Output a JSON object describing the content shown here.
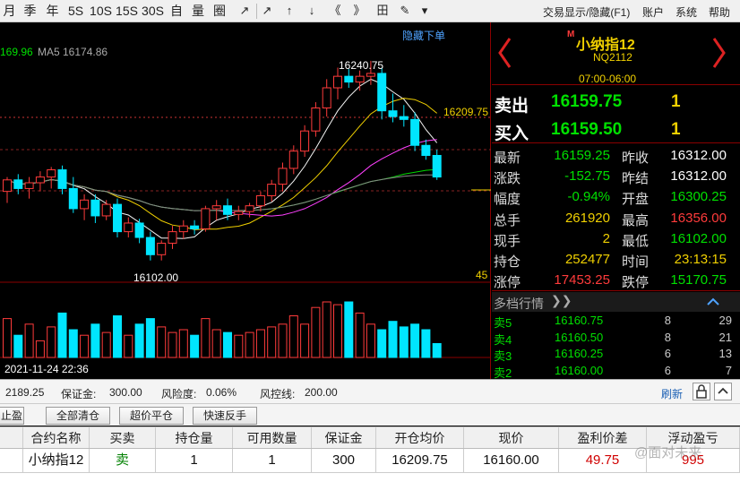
{
  "toolbar": {
    "periods": [
      "月",
      "季",
      "年",
      "5S",
      "10S",
      "15S",
      "30S",
      "自",
      "量",
      "圈"
    ],
    "tools": [
      "↗",
      "↗",
      "↑",
      "↓",
      "《",
      "》",
      "田",
      "✎",
      "▾"
    ],
    "tool_icons": [
      "arrow-diagonal-icon",
      "compress-icon",
      "up-arrow-icon",
      "down-arrow-icon",
      "double-left-icon",
      "double-right-icon",
      "grid-icon",
      "pen-icon",
      "dropdown-icon"
    ],
    "menu": {
      "trade_toggle": "交易显示/隐藏(F1)",
      "account": "账户",
      "system": "系统",
      "help": "帮助"
    }
  },
  "chart": {
    "ma_first_value": "169.96",
    "ma5_label": "MA5",
    "ma5_value": "16174.86",
    "hide_order_link": "隐藏下单",
    "high_label": "16240.75",
    "low_label": "16102.00",
    "price_line_label": "16209.75",
    "countdown_label": "45",
    "datetime_label": "2021-11-24 22:36",
    "colors": {
      "up": "#ff3b3b",
      "down": "#00e5ff",
      "ma5": "#f5f5f5",
      "ma10": "#f0d000",
      "ma20": "#ff40ff",
      "ma60": "#00d800",
      "ma_long": "#888888"
    }
  },
  "chart_data": {
    "type": "candlestick",
    "symbol": "小纳指12",
    "ylim": [
      16090,
      16255
    ],
    "high": 16240.75,
    "low": 16102.0,
    "last_visible_time": "2021-11-24 22:36",
    "candles": [
      {
        "o": 16150,
        "h": 16160,
        "l": 16142,
        "c": 16158
      },
      {
        "o": 16158,
        "h": 16162,
        "l": 16148,
        "c": 16152
      },
      {
        "o": 16152,
        "h": 16160,
        "l": 16145,
        "c": 16156
      },
      {
        "o": 16156,
        "h": 16164,
        "l": 16150,
        "c": 16160
      },
      {
        "o": 16160,
        "h": 16167,
        "l": 16152,
        "c": 16165
      },
      {
        "o": 16165,
        "h": 16168,
        "l": 16148,
        "c": 16152
      },
      {
        "o": 16152,
        "h": 16160,
        "l": 16135,
        "c": 16138
      },
      {
        "o": 16138,
        "h": 16148,
        "l": 16130,
        "c": 16144
      },
      {
        "o": 16144,
        "h": 16148,
        "l": 16128,
        "c": 16133
      },
      {
        "o": 16133,
        "h": 16144,
        "l": 16130,
        "c": 16141
      },
      {
        "o": 16141,
        "h": 16145,
        "l": 16118,
        "c": 16122
      },
      {
        "o": 16122,
        "h": 16132,
        "l": 16118,
        "c": 16128
      },
      {
        "o": 16128,
        "h": 16131,
        "l": 16114,
        "c": 16118
      },
      {
        "o": 16118,
        "h": 16122,
        "l": 16102,
        "c": 16106
      },
      {
        "o": 16106,
        "h": 16116,
        "l": 16102,
        "c": 16114
      },
      {
        "o": 16114,
        "h": 16126,
        "l": 16110,
        "c": 16122
      },
      {
        "o": 16122,
        "h": 16130,
        "l": 16117,
        "c": 16126
      },
      {
        "o": 16126,
        "h": 16130,
        "l": 16120,
        "c": 16124
      },
      {
        "o": 16124,
        "h": 16140,
        "l": 16122,
        "c": 16138
      },
      {
        "o": 16138,
        "h": 16144,
        "l": 16130,
        "c": 16140
      },
      {
        "o": 16140,
        "h": 16145,
        "l": 16130,
        "c": 16134
      },
      {
        "o": 16134,
        "h": 16140,
        "l": 16130,
        "c": 16136
      },
      {
        "o": 16136,
        "h": 16142,
        "l": 16132,
        "c": 16140
      },
      {
        "o": 16140,
        "h": 16150,
        "l": 16136,
        "c": 16147
      },
      {
        "o": 16147,
        "h": 16158,
        "l": 16143,
        "c": 16155
      },
      {
        "o": 16155,
        "h": 16170,
        "l": 16150,
        "c": 16166
      },
      {
        "o": 16166,
        "h": 16182,
        "l": 16162,
        "c": 16178
      },
      {
        "o": 16178,
        "h": 16196,
        "l": 16174,
        "c": 16192
      },
      {
        "o": 16192,
        "h": 16212,
        "l": 16188,
        "c": 16208
      },
      {
        "o": 16208,
        "h": 16228,
        "l": 16202,
        "c": 16222
      },
      {
        "o": 16222,
        "h": 16236,
        "l": 16214,
        "c": 16230
      },
      {
        "o": 16230,
        "h": 16235,
        "l": 16222,
        "c": 16226
      },
      {
        "o": 16226,
        "h": 16234,
        "l": 16220,
        "c": 16230
      },
      {
        "o": 16230,
        "h": 16240.75,
        "l": 16224,
        "c": 16232
      },
      {
        "o": 16232,
        "h": 16236,
        "l": 16200,
        "c": 16206
      },
      {
        "o": 16206,
        "h": 16218,
        "l": 16198,
        "c": 16202
      },
      {
        "o": 16202,
        "h": 16210,
        "l": 16195,
        "c": 16200
      },
      {
        "o": 16200,
        "h": 16205,
        "l": 16178,
        "c": 16182
      },
      {
        "o": 16182,
        "h": 16186,
        "l": 16172,
        "c": 16175
      },
      {
        "o": 16175,
        "h": 16179,
        "l": 16158,
        "c": 16160
      }
    ],
    "volumes": [
      70,
      40,
      60,
      30,
      55,
      80,
      50,
      40,
      60,
      45,
      75,
      40,
      60,
      70,
      55,
      45,
      50,
      40,
      70,
      50,
      45,
      40,
      45,
      50,
      55,
      60,
      75,
      60,
      90,
      100,
      95,
      100,
      80,
      60,
      50,
      65,
      55,
      60,
      50,
      25
    ]
  },
  "quote": {
    "name": "小纳指12",
    "name_prefix": "M",
    "code": "NQ2112",
    "session": "07:00-06:00",
    "sell_label": "卖出",
    "sell_price": "16159.75",
    "sell_qty": "1",
    "buy_label": "买入",
    "buy_price": "16159.50",
    "buy_qty": "1",
    "rows": [
      {
        "l1": "最新",
        "v1": "16159.25",
        "c1": "#00e000",
        "l2": "昨收",
        "v2": "16312.00",
        "c2": "#ffffff"
      },
      {
        "l1": "涨跌",
        "v1": "-152.75",
        "c1": "#00e000",
        "l2": "昨结",
        "v2": "16312.00",
        "c2": "#ffffff"
      },
      {
        "l1": "幅度",
        "v1": "-0.94%",
        "c1": "#00e000",
        "l2": "开盘",
        "v2": "16300.25",
        "c2": "#00e000"
      },
      {
        "l1": "总手",
        "v1": "261920",
        "c1": "#f0d000",
        "l2": "最高",
        "v2": "16356.00",
        "c2": "#ff3b3b"
      },
      {
        "l1": "现手",
        "v1": "2",
        "c1": "#f0d000",
        "l2": "最低",
        "v2": "16102.00",
        "c2": "#00e000"
      },
      {
        "l1": "持仓",
        "v1": "252477",
        "c1": "#f0d000",
        "l2": "时间",
        "v2": "23:13:15",
        "c2": "#f0d000"
      },
      {
        "l1": "涨停",
        "v1": "17453.25",
        "c1": "#ff3b3b",
        "l2": "跌停",
        "v2": "15170.75",
        "c2": "#00e000"
      }
    ],
    "depth_title": "多档行情",
    "depth": [
      {
        "label": "卖5",
        "price": "16160.75",
        "qty": "8",
        "orders": "29"
      },
      {
        "label": "卖4",
        "price": "16160.50",
        "qty": "8",
        "orders": "21"
      },
      {
        "label": "卖3",
        "price": "16160.25",
        "qty": "6",
        "orders": "13"
      },
      {
        "label": "卖2",
        "price": "16160.00",
        "qty": "6",
        "orders": "7"
      }
    ]
  },
  "status": {
    "balance": "2189.25",
    "margin_label": "保证金:",
    "margin": "300.00",
    "risk_label": "风险度:",
    "risk": "0.06%",
    "stop_label": "风控线:",
    "stop": "200.00",
    "refresh": "刷新"
  },
  "actions": {
    "stop_tab": "止盈",
    "close_all": "全部清仓",
    "super_close": "超价平仓",
    "quick_reverse": "快速反手"
  },
  "positions": {
    "headers": [
      "合约名称",
      "买卖",
      "持仓量",
      "可用数量",
      "保证金",
      "开仓均价",
      "现价",
      "盈利价差",
      "浮动盈亏"
    ],
    "rows": [
      {
        "name": "小纳指12",
        "side": "卖",
        "qty": "1",
        "avail": "1",
        "margin": "300",
        "open_avg": "16209.75",
        "price": "16160.00",
        "diff": "49.75",
        "pnl": "995"
      }
    ],
    "watermark": "@面对未来"
  }
}
